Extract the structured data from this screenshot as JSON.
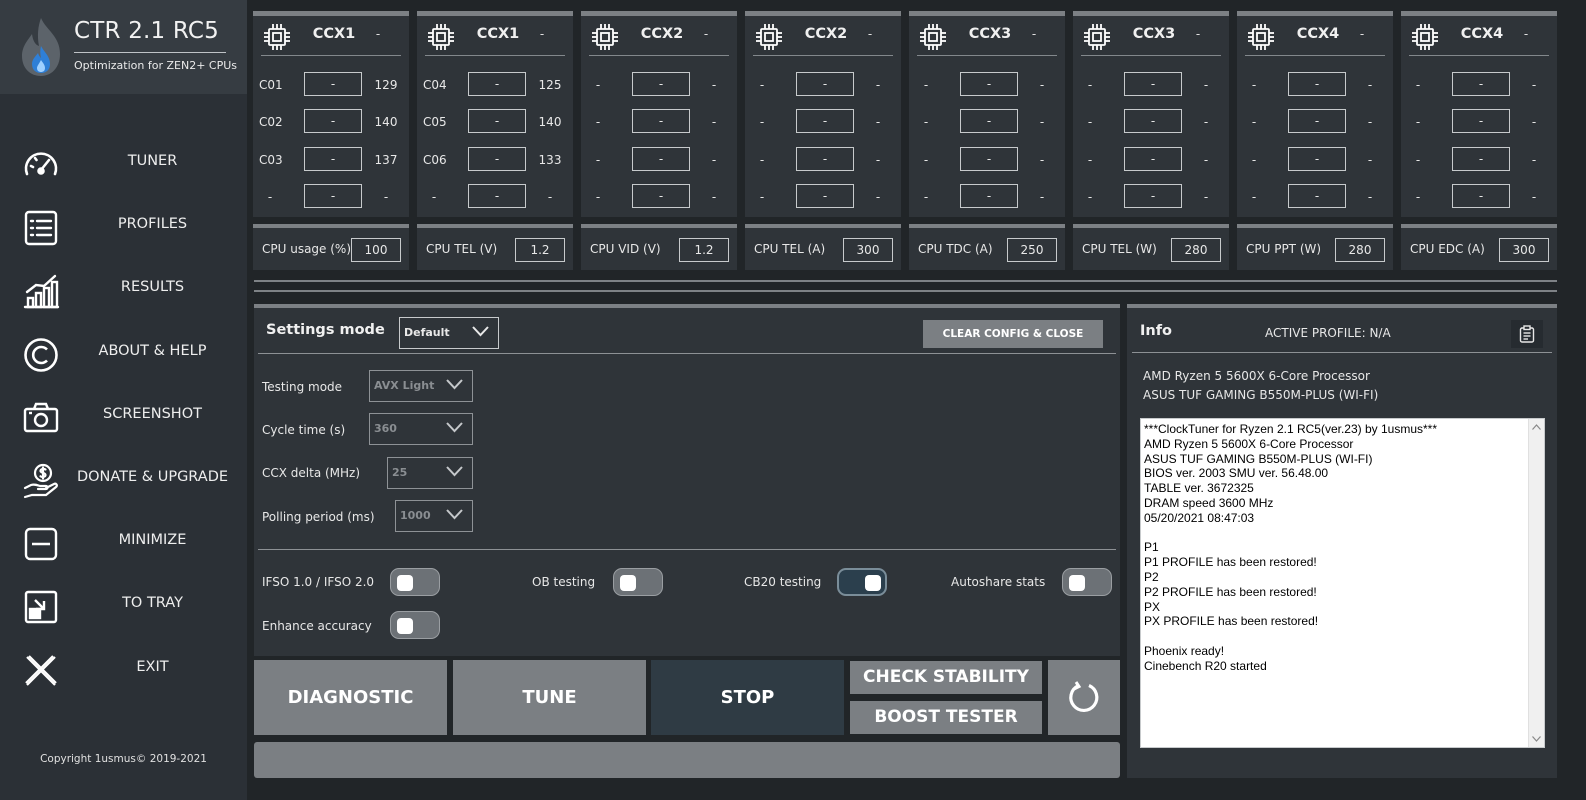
{
  "app": {
    "title": "CTR 2.1 RC5",
    "subtitle": "Optimization for ZEN2+ CPUs",
    "copyright": "Copyright 1usmus© 2019-2021"
  },
  "nav": [
    {
      "label": "TUNER",
      "icon": "gauge-icon"
    },
    {
      "label": "PROFILES",
      "icon": "list-icon"
    },
    {
      "label": "RESULTS",
      "icon": "chart-icon"
    },
    {
      "label": "ABOUT & HELP",
      "icon": "copyright-icon"
    },
    {
      "label": "SCREENSHOT",
      "icon": "camera-icon"
    },
    {
      "label": "DONATE & UPGRADE",
      "icon": "donate-icon"
    },
    {
      "label": "MINIMIZE",
      "icon": "minimize-icon"
    },
    {
      "label": "TO TRAY",
      "icon": "tray-icon"
    },
    {
      "label": "EXIT",
      "icon": "close-icon"
    }
  ],
  "ccx": [
    {
      "name": "CCX1",
      "value": "-",
      "cores": [
        {
          "name": "C01",
          "field": "-",
          "value": "129"
        },
        {
          "name": "C02",
          "field": "-",
          "value": "140"
        },
        {
          "name": "C03",
          "field": "-",
          "value": "137"
        },
        {
          "name": "-",
          "field": "-",
          "value": "-"
        }
      ]
    },
    {
      "name": "CCX1",
      "value": "-",
      "cores": [
        {
          "name": "C04",
          "field": "-",
          "value": "125"
        },
        {
          "name": "C05",
          "field": "-",
          "value": "140"
        },
        {
          "name": "C06",
          "field": "-",
          "value": "133"
        },
        {
          "name": "-",
          "field": "-",
          "value": "-"
        }
      ]
    },
    {
      "name": "CCX2",
      "value": "-",
      "cores": [
        {
          "name": "-",
          "field": "-",
          "value": "-"
        },
        {
          "name": "-",
          "field": "-",
          "value": "-"
        },
        {
          "name": "-",
          "field": "-",
          "value": "-"
        },
        {
          "name": "-",
          "field": "-",
          "value": "-"
        }
      ]
    },
    {
      "name": "CCX2",
      "value": "-",
      "cores": [
        {
          "name": "-",
          "field": "-",
          "value": "-"
        },
        {
          "name": "-",
          "field": "-",
          "value": "-"
        },
        {
          "name": "-",
          "field": "-",
          "value": "-"
        },
        {
          "name": "-",
          "field": "-",
          "value": "-"
        }
      ]
    },
    {
      "name": "CCX3",
      "value": "-",
      "cores": [
        {
          "name": "-",
          "field": "-",
          "value": "-"
        },
        {
          "name": "-",
          "field": "-",
          "value": "-"
        },
        {
          "name": "-",
          "field": "-",
          "value": "-"
        },
        {
          "name": "-",
          "field": "-",
          "value": "-"
        }
      ]
    },
    {
      "name": "CCX3",
      "value": "-",
      "cores": [
        {
          "name": "-",
          "field": "-",
          "value": "-"
        },
        {
          "name": "-",
          "field": "-",
          "value": "-"
        },
        {
          "name": "-",
          "field": "-",
          "value": "-"
        },
        {
          "name": "-",
          "field": "-",
          "value": "-"
        }
      ]
    },
    {
      "name": "CCX4",
      "value": "-",
      "cores": [
        {
          "name": "-",
          "field": "-",
          "value": "-"
        },
        {
          "name": "-",
          "field": "-",
          "value": "-"
        },
        {
          "name": "-",
          "field": "-",
          "value": "-"
        },
        {
          "name": "-",
          "field": "-",
          "value": "-"
        }
      ]
    },
    {
      "name": "CCX4",
      "value": "-",
      "cores": [
        {
          "name": "-",
          "field": "-",
          "value": "-"
        },
        {
          "name": "-",
          "field": "-",
          "value": "-"
        },
        {
          "name": "-",
          "field": "-",
          "value": "-"
        },
        {
          "name": "-",
          "field": "-",
          "value": "-"
        }
      ]
    }
  ],
  "limits": [
    {
      "label": "CPU usage (%)",
      "value": "100"
    },
    {
      "label": "CPU TEL (V)",
      "value": "1.2"
    },
    {
      "label": "CPU VID (V)",
      "value": "1.2"
    },
    {
      "label": "CPU TEL (A)",
      "value": "300"
    },
    {
      "label": "CPU TDC (A)",
      "value": "250"
    },
    {
      "label": "CPU TEL (W)",
      "value": "280"
    },
    {
      "label": "CPU PPT (W)",
      "value": "280"
    },
    {
      "label": "CPU EDC (A)",
      "value": "300"
    }
  ],
  "settings": {
    "title": "Settings mode",
    "mode_value": "Default",
    "clear_label": "CLEAR CONFIG & CLOSE",
    "testing_mode": {
      "label": "Testing mode",
      "value": "AVX Light"
    },
    "cycle_time": {
      "label": "Cycle time (s)",
      "value": "360"
    },
    "ccx_delta": {
      "label": "CCX delta (MHz)",
      "value": "25"
    },
    "polling": {
      "label": "Polling period (ms)",
      "value": "1000"
    },
    "toggles": [
      {
        "label": "IFSO 1.0 / IFSO 2.0",
        "on": false
      },
      {
        "label": "OB testing",
        "on": false
      },
      {
        "label": "CB20 testing",
        "on": true
      },
      {
        "label": "Autoshare stats",
        "on": false
      },
      {
        "label": "Enhance accuracy",
        "on": false
      }
    ]
  },
  "actions": {
    "diagnostic": "DIAGNOSTIC",
    "tune": "TUNE",
    "stop": "STOP",
    "check_stability": "CHECK STABILITY",
    "boost_tester": "BOOST TESTER"
  },
  "info": {
    "title": "Info",
    "active_profile": "ACTIVE PROFILE: N/A",
    "cpu": "AMD Ryzen 5 5600X 6-Core Processor",
    "board": "ASUS TUF GAMING B550M-PLUS (WI-FI)",
    "log": [
      "***ClockTuner for Ryzen 2.1 RC5(ver.23) by 1usmus***",
      "AMD Ryzen 5 5600X 6-Core Processor",
      "ASUS TUF GAMING B550M-PLUS (WI-FI)",
      "BIOS ver. 2003 SMU ver. 56.48.00",
      "TABLE ver. 3672325",
      "DRAM speed 3600 MHz",
      "05/20/2021 08:47:03",
      "",
      "P1",
      "P1 PROFILE has been restored!",
      "P2",
      "P2 PROFILE has been restored!",
      "PX",
      "PX PROFILE has been restored!",
      "",
      "Phoenix ready!",
      "Cinebench R20 started"
    ]
  },
  "colors": {
    "background": "#212528",
    "panel": "#2f3439",
    "sidebar": "#2b3036",
    "button_gray": "#7b7f83",
    "button_dark": "#2f3b44"
  }
}
